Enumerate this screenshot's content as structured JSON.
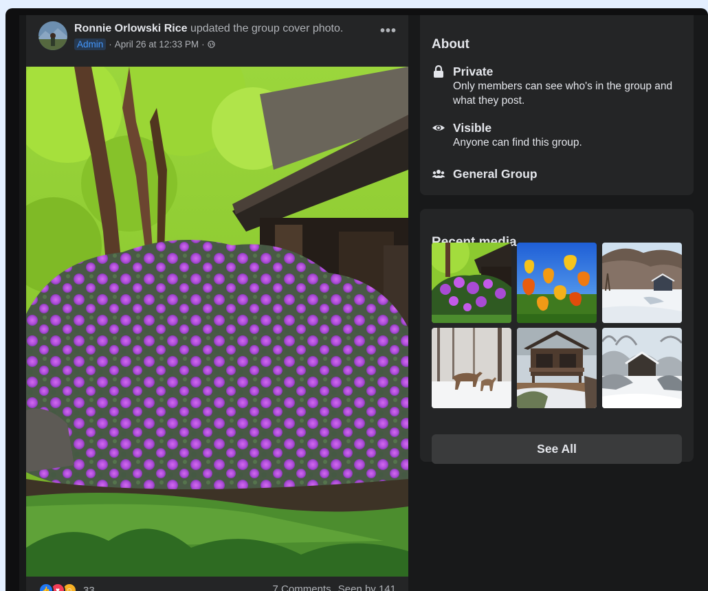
{
  "post": {
    "author": "Ronnie Orlowski Rice",
    "action": "updated the group cover photo.",
    "badge": "Admin",
    "separator": "·",
    "timestamp": "April 26 at 12:33 PM",
    "timestamp_separator": "·",
    "privacy_icon": "globe-icon",
    "more_label": "•••",
    "photo_alt": "Purple rhododendron bush beside a log cabin",
    "reactions": {
      "icons": [
        "like-icon",
        "love-icon",
        "care-icon"
      ],
      "count": "33"
    },
    "comments": "7 Comments",
    "seen": "Seen by 141"
  },
  "about": {
    "title": "About",
    "items": [
      {
        "icon": "lock-icon",
        "title": "Private",
        "description": "Only members can see who's in the group and what they post."
      },
      {
        "icon": "eye-icon",
        "title": "Visible",
        "description": "Anyone can find this group."
      },
      {
        "icon": "people-icon",
        "title": "General Group",
        "description": ""
      }
    ]
  },
  "recent_media": {
    "title": "Recent media",
    "thumbnails": [
      "rhododendron-cabin",
      "tulips",
      "snowy-mountain-cabin",
      "deer-in-snow",
      "cabin-porch",
      "snowy-cabin-woods"
    ],
    "see_all_label": "See All"
  },
  "colors": {
    "page_background": "#18191a",
    "card_background": "#242526",
    "primary_text": "#e4e6eb",
    "secondary_text": "#b0b3b8",
    "admin_badge_text": "#4599ff",
    "button_background": "#3a3b3c"
  }
}
